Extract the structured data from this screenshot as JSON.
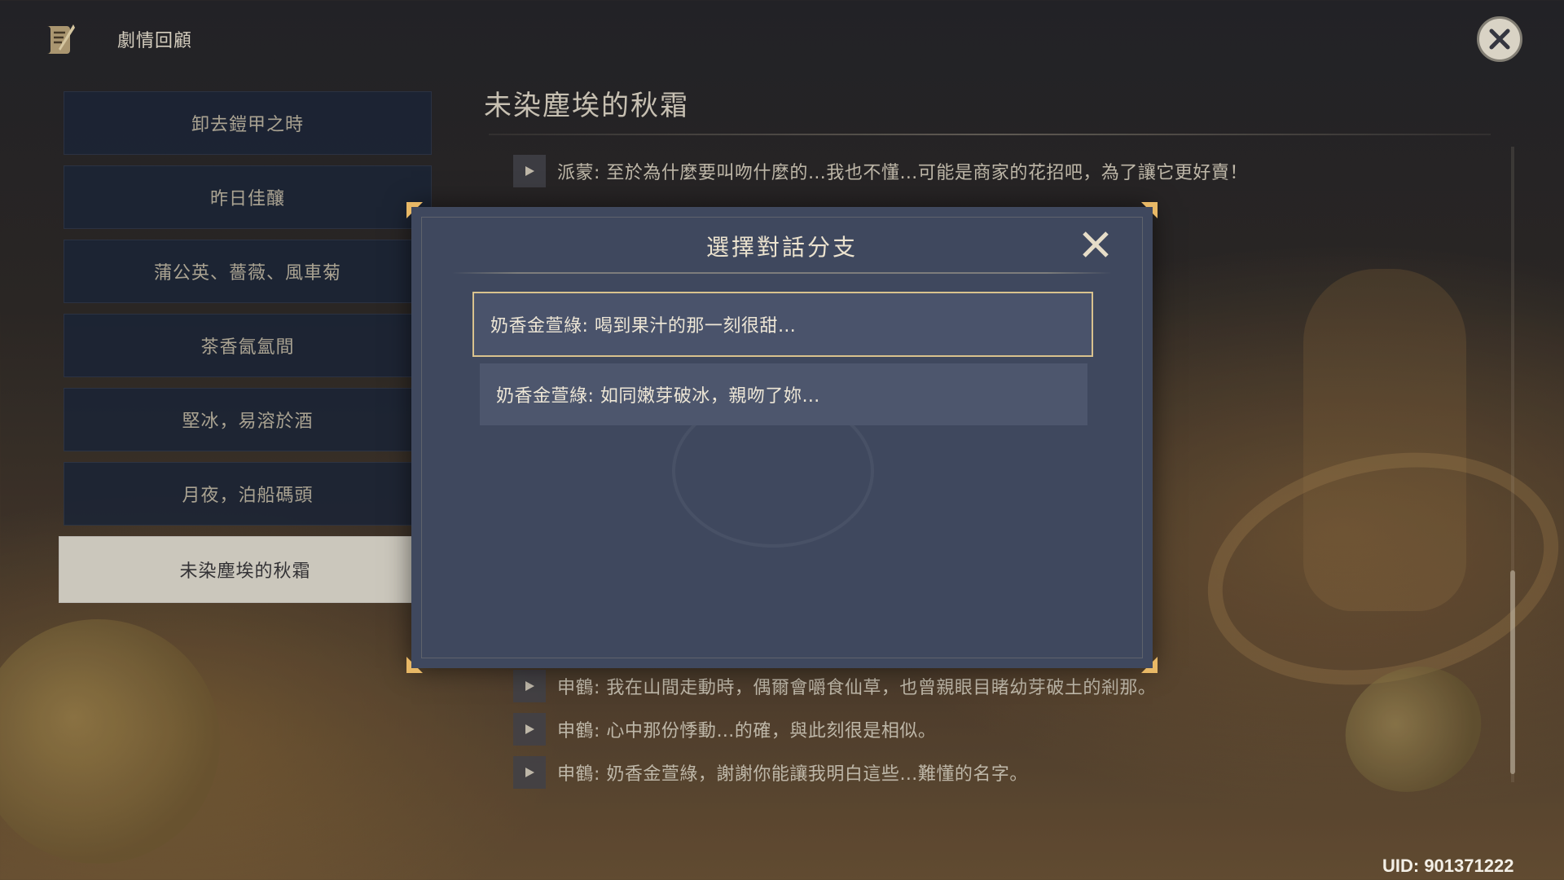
{
  "header": {
    "title": "劇情回顧",
    "icon": "scroll-quill-icon",
    "close_icon": "close-icon"
  },
  "sidebar": {
    "chapters": [
      {
        "label": "卸去鎧甲之時"
      },
      {
        "label": "昨日佳釀"
      },
      {
        "label": "蒲公英、薔薇、風車菊"
      },
      {
        "label": "茶香氤氳間"
      },
      {
        "label": "堅冰，易溶於酒"
      },
      {
        "label": "月夜，泊船碼頭"
      },
      {
        "label": "未染塵埃的秋霜"
      }
    ],
    "active_index": 6
  },
  "main": {
    "title": "未染塵埃的秋霜",
    "lines": [
      {
        "text": "派蒙: 至於為什麼要叫吻什麼的…我也不懂…可能是商家的花招吧，為了讓它更好賣！"
      },
      {
        "text": "申鶴: 我在山間走動時，偶爾會嚼食仙草，也曾親眼目睹幼芽破土的剎那。"
      },
      {
        "text": "申鶴: 心中那份悸動…的確，與此刻很是相似。"
      },
      {
        "text": "申鶴: 奶香金萱綠，謝謝你能讓我明白這些…難懂的名字。"
      }
    ]
  },
  "dialog": {
    "title": "選擇對話分支",
    "close_icon": "close-icon",
    "options": [
      {
        "label": "奶香金萱綠: 喝到果汁的那一刻很甜…"
      },
      {
        "label": "奶香金萱綠: 如同嫩芽破冰，親吻了妳…"
      }
    ],
    "selected_index": 0
  },
  "footer": {
    "uid": "UID: 901371222"
  },
  "colors": {
    "modal_bg": "#3f485e",
    "selected_border": "#d9c28e",
    "corner_accent": "#e8b866",
    "active_chapter_bg": "#ddd8cc"
  }
}
